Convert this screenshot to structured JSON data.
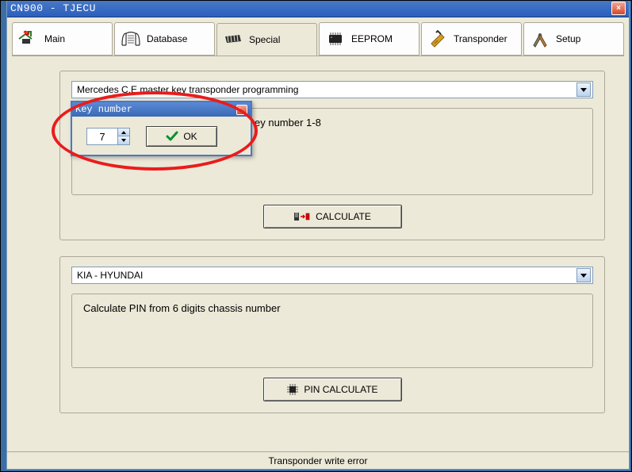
{
  "window": {
    "title": "CN900 - TJECU",
    "close": "×"
  },
  "tabs": [
    {
      "label": "Main"
    },
    {
      "label": "Database"
    },
    {
      "label": "Special"
    },
    {
      "label": "EEPROM"
    },
    {
      "label": "Transponder"
    },
    {
      "label": "Setup"
    }
  ],
  "group1": {
    "combo": "Mercedes C,E master key transponder programming",
    "inner_text": "ey number 1-8",
    "calc_label": "CALCULATE"
  },
  "dialog": {
    "title": "Key number",
    "value": "7",
    "ok": "OK"
  },
  "group2": {
    "combo": "KIA - HYUNDAI",
    "inner_text": "Calculate PIN from 6 digits chassis number",
    "calc_label": "PIN CALCULATE"
  },
  "status": "Transponder write error"
}
